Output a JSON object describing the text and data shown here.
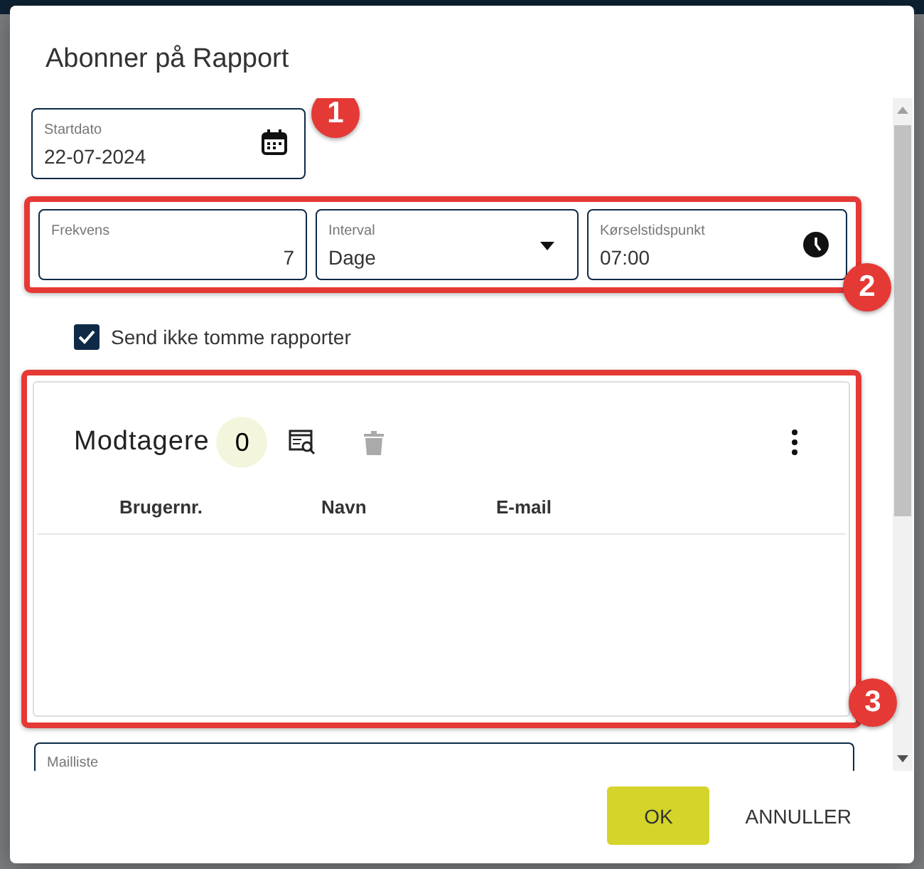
{
  "dialog": {
    "title": "Abonner på Rapport"
  },
  "start_date": {
    "label": "Startdato",
    "value": "22-07-2024"
  },
  "schedule": {
    "frequency": {
      "label": "Frekvens",
      "value": "7"
    },
    "interval": {
      "label": "Interval",
      "value": "Dage"
    },
    "run_time": {
      "label": "Kørselstidspunkt",
      "value": "07:00"
    }
  },
  "skip_empty": {
    "label": "Send ikke tomme rapporter",
    "checked": true
  },
  "recipients": {
    "title": "Modtagere",
    "count": "0",
    "columns": [
      "Brugernr.",
      "Navn",
      "E-mail"
    ]
  },
  "mailing_list": {
    "label": "Mailliste"
  },
  "annotations": [
    {
      "label": "1"
    },
    {
      "label": "2"
    },
    {
      "label": "3"
    }
  ],
  "buttons": [
    {
      "label": "OK",
      "kind": "primary"
    },
    {
      "label": "ANNULLER",
      "kind": "text"
    }
  ]
}
